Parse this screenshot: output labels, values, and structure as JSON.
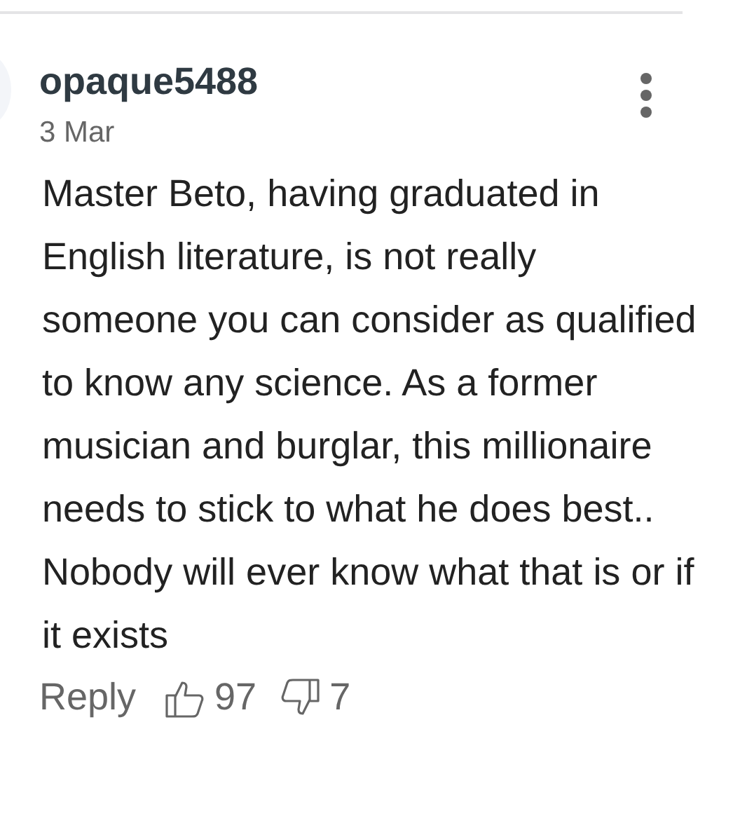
{
  "comment": {
    "username": "opaque5488",
    "date": "3 Mar",
    "body": "Master Beto, having graduated in English literature, is not really someone you can consider as qualified to know any science. As a former musician and burglar, this millionaire needs to stick to what he does best.. Nobody will ever know what that is or if it exists",
    "reply": "Reply",
    "upvotes": "97",
    "downvotes": "7"
  }
}
